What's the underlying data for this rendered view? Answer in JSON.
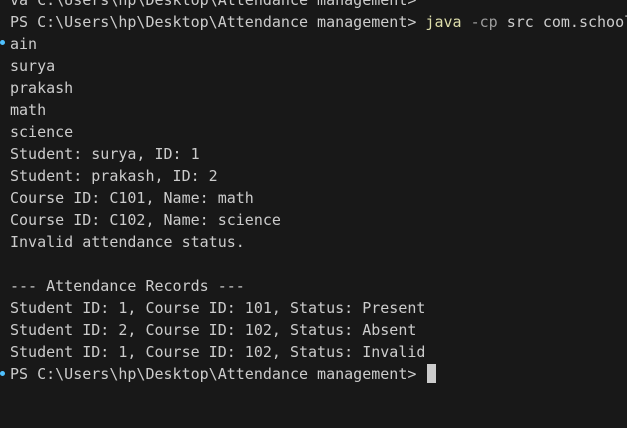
{
  "terminal": {
    "colors": {
      "background": "#181818",
      "text": "#cccccc",
      "command": "#dcdcaa",
      "flag": "#9d9d9d",
      "marker": "#4fc1ff"
    },
    "top_partial_line": "va C:\\Users\\hp\\Desktop\\Attendance management>",
    "command_prompt": {
      "prompt": "PS C:\\Users\\hp\\Desktop\\Attendance management> ",
      "exe": "java",
      "flag": " -cp",
      "args": " src com.school"
    },
    "output": [
      "ain",
      "surya",
      "prakash",
      "math",
      "science",
      "Student: surya, ID: 1",
      "Student: prakash, ID: 2",
      "Course ID: C101, Name: math",
      "Course ID: C102, Name: science",
      "Invalid attendance status.",
      "",
      "--- Attendance Records ---",
      "Student ID: 1, Course ID: 101, Status: Present",
      "Student ID: 2, Course ID: 102, Status: Absent",
      "Student ID: 1, Course ID: 102, Status: Invalid"
    ],
    "final_prompt": "PS C:\\Users\\hp\\Desktop\\Attendance management> "
  }
}
